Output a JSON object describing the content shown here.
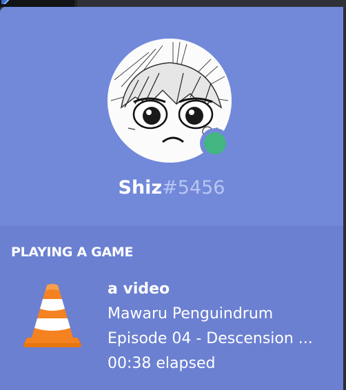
{
  "user": {
    "name": "Shiz",
    "discriminator": "#5456",
    "status": "online",
    "avatar_icon": "manga-face-avatar"
  },
  "activity": {
    "heading": "PLAYING A GAME",
    "game_icon": "vlc-cone-icon",
    "game_name": "a video",
    "details": "Mawaru Penguindrum",
    "state": "Episode 04 - Descension ...",
    "elapsed": "00:38 elapsed"
  },
  "colors": {
    "card_background": "#7289da",
    "activity_background": "#6b80d1",
    "online_status": "#43b581",
    "discriminator_text": "#b9c6f1",
    "vlc_orange": "#f58220"
  }
}
